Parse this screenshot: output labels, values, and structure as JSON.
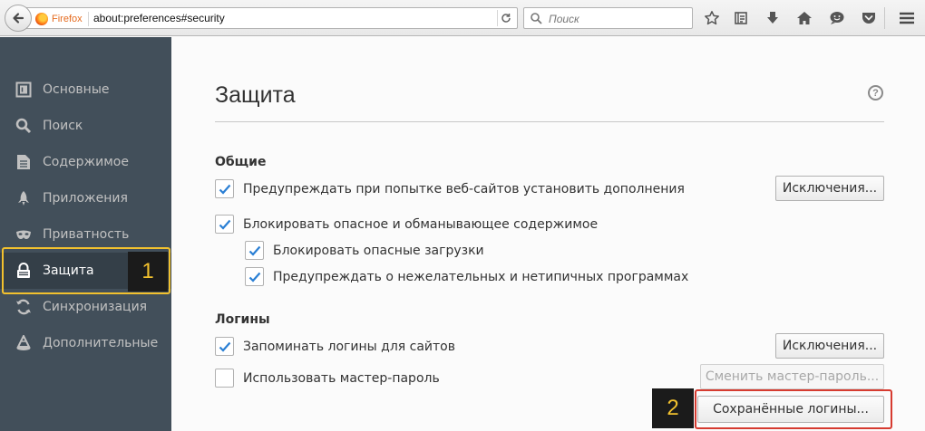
{
  "toolbar": {
    "identity_label": "Firefox",
    "url": "about:preferences#security",
    "search_placeholder": "Поиск"
  },
  "sidebar": {
    "items": [
      {
        "label": "Основные",
        "icon": "general-icon"
      },
      {
        "label": "Поиск",
        "icon": "search-icon"
      },
      {
        "label": "Содержимое",
        "icon": "content-icon"
      },
      {
        "label": "Приложения",
        "icon": "applications-icon"
      },
      {
        "label": "Приватность",
        "icon": "privacy-mask-icon"
      },
      {
        "label": "Защита",
        "icon": "security-lock-icon",
        "selected": true
      },
      {
        "label": "Синхронизация",
        "icon": "sync-icon"
      },
      {
        "label": "Дополнительные",
        "icon": "advanced-icon"
      }
    ]
  },
  "main": {
    "title": "Защита",
    "general": {
      "heading": "Общие",
      "warn_addons": {
        "label": "Предупреждать при попытке веб-сайтов установить дополнения",
        "checked": true
      },
      "block_dangerous": {
        "label": "Блокировать опасное и обманывающее содержимое",
        "checked": true
      },
      "block_downloads": {
        "label": "Блокировать опасные загрузки",
        "checked": true
      },
      "warn_unwanted": {
        "label": "Предупреждать о нежелательных и нетипичных программах",
        "checked": true
      },
      "exceptions_button": "Исключения..."
    },
    "logins": {
      "heading": "Логины",
      "remember": {
        "label": "Запоминать логины для сайтов",
        "checked": true
      },
      "master_password": {
        "label": "Использовать мастер-пароль",
        "checked": false
      },
      "exceptions_button": "Исключения...",
      "change_master_button": "Сменить мастер-пароль...",
      "saved_logins_button": "Сохранённые логины..."
    }
  },
  "annotations": {
    "step1": "1",
    "step2": "2",
    "highlight_color": "#f2c12e",
    "button_highlight_color": "#d63b30"
  }
}
